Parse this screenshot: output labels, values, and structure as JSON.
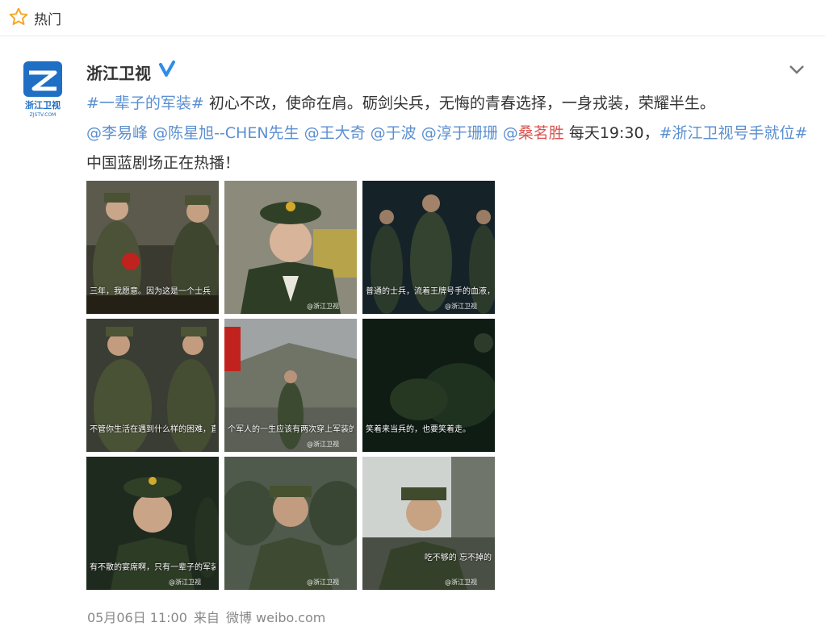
{
  "topbar": {
    "label": "热门",
    "icon": "star-icon"
  },
  "post": {
    "author": "浙江卫视",
    "verified_icon": "verified-badge-icon",
    "avatar_text": "浙江卫视",
    "avatar_sub": "ZJSTV.COM",
    "text_parts": {
      "tag1": "#一辈子的军装#",
      "t1": " 初心不改，使命在肩。砺剑尖兵，无悔的青春选择，一身戎装，荣耀半生。",
      "m1": "@李易峰",
      "m2": "@陈星旭--CHEN先生",
      "m3": "@王大奇",
      "m4": "@于波",
      "m5": "@淳于珊珊",
      "m6a": "@",
      "m6b": "桑茗胜",
      "t2": " 每天19:30，",
      "tag2": "#浙江卫视号手就位#",
      "t3": " 中国蓝剧场正在热播！"
    },
    "images": [
      {
        "caption": "三年，我愿意。因为这是一个士兵",
        "watermark": ""
      },
      {
        "caption": "",
        "watermark": "@浙江卫视"
      },
      {
        "caption": "普通的士兵，流着王牌号手的血液，你是火箭",
        "watermark": "@浙江卫视"
      },
      {
        "caption": "不管你生活在遇到什么样的困难，直了，你给我杵在那儿",
        "watermark": ""
      },
      {
        "caption": "个军人的一生应该有两次穿上军装的机会，一次是新兵入伍，第二次就是脱下",
        "watermark": "@浙江卫视"
      },
      {
        "caption": "笑着来当兵的，也要笑着走。",
        "watermark": ""
      },
      {
        "caption": "有不散的宴席啊，只有一辈子的军装",
        "watermark": "@浙江卫视"
      },
      {
        "caption": "",
        "watermark": "@浙江卫视"
      },
      {
        "caption": "吃不够的 忘不掉的",
        "watermark": "@浙江卫视"
      }
    ],
    "footer": {
      "date": "05月06日 11:00",
      "source_prefix": "来自",
      "source": "微博 weibo.com"
    }
  },
  "colors": {
    "link": "#5b8fd0",
    "mention_red": "#d9534f",
    "star": "#f5a623",
    "verified": "#2e8de6"
  }
}
